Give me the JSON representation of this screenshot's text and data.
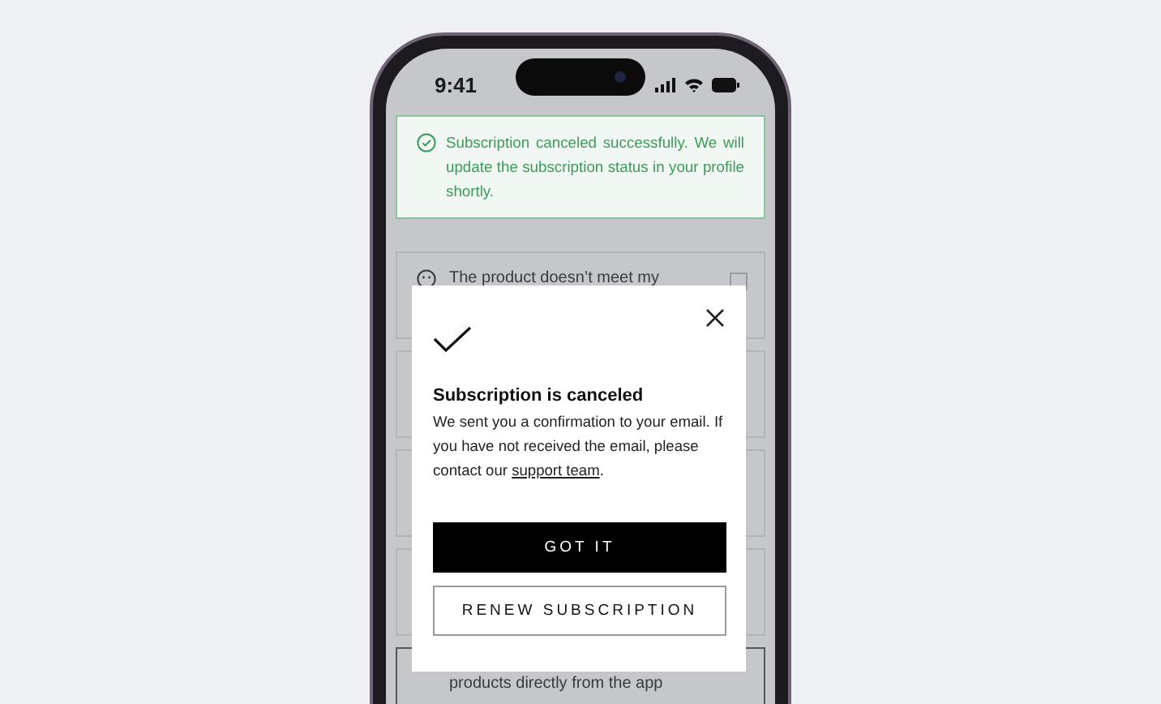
{
  "status_bar": {
    "time": "9:41"
  },
  "toast": {
    "message": "Subscription canceled successfully. We will update the subscription status in your profile shortly."
  },
  "options": [
    {
      "text": "The product doesn’t meet my",
      "selected": false
    },
    {
      "selected": false
    },
    {
      "selected": false
    },
    {
      "selected": false
    },
    {
      "text": "products directly from the app",
      "selected": true
    }
  ],
  "dialog": {
    "title": "Subscription is canceled",
    "body": "We sent you a confirmation to your email. If you have not received the email, please contact our ",
    "link": "support team",
    "body_end": ".",
    "buttons": [
      {
        "label": "GOT IT",
        "kind": "primary"
      },
      {
        "label": "RENEW SUBSCRIPTION",
        "kind": "secondary"
      }
    ]
  }
}
